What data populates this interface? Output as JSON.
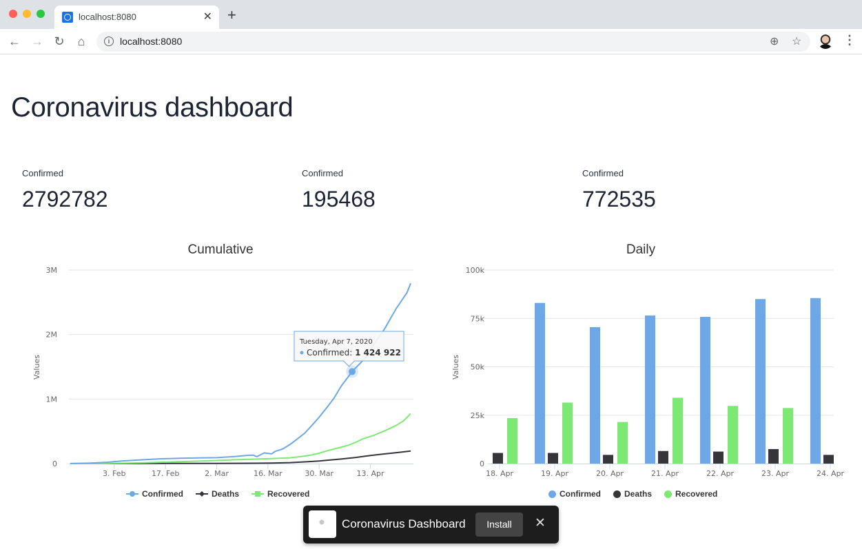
{
  "browser": {
    "tab_title": "localhost:8080",
    "url": "localhost:8080",
    "icons": {
      "back": "arrow-left-icon",
      "forward": "arrow-right-icon",
      "reload": "reload-icon",
      "home": "home-icon",
      "info": "info-icon",
      "add": "plus-circle-icon",
      "bookmark": "star-icon",
      "menu": "vertical-dots-icon"
    }
  },
  "page": {
    "title": "Coronavirus dashboard",
    "stats": [
      {
        "label": "Confirmed",
        "value": "2792782"
      },
      {
        "label": "Confirmed",
        "value": "195468"
      },
      {
        "label": "Confirmed",
        "value": "772535"
      }
    ]
  },
  "colors": {
    "confirmed": "#6ca8e6",
    "deaths": "#35353b",
    "recovered": "#7de874"
  },
  "chart_data": [
    {
      "type": "line",
      "title": "Cumulative",
      "xlabel": "",
      "ylabel": "Values",
      "ylim": [
        0,
        3000000
      ],
      "yticks": [
        {
          "v": 0,
          "label": "0"
        },
        {
          "v": 1000000,
          "label": "1M"
        },
        {
          "v": 2000000,
          "label": "2M"
        },
        {
          "v": 3000000,
          "label": "3M"
        }
      ],
      "xticks": [
        {
          "day": 12,
          "label": "3. Feb"
        },
        {
          "day": 26,
          "label": "17. Feb"
        },
        {
          "day": 40,
          "label": "2. Mar"
        },
        {
          "day": 54,
          "label": "16. Mar"
        },
        {
          "day": 68,
          "label": "30. Mar"
        },
        {
          "day": 82,
          "label": "13. Apr"
        }
      ],
      "x_start": "2020-01-22",
      "x_days": 93,
      "grid": true,
      "legend": "bottom-center",
      "series": [
        {
          "name": "Confirmed",
          "key": "confirmed",
          "points": [
            [
              0,
              555
            ],
            [
              5,
              6000
            ],
            [
              10,
              20000
            ],
            [
              14,
              40000
            ],
            [
              20,
              60000
            ],
            [
              25,
              75000
            ],
            [
              30,
              82000
            ],
            [
              35,
              88000
            ],
            [
              40,
              92000
            ],
            [
              45,
              110000
            ],
            [
              48,
              125000
            ],
            [
              50,
              130000
            ],
            [
              51,
              108000
            ],
            [
              53,
              165000
            ],
            [
              55,
              150000
            ],
            [
              56,
              190000
            ],
            [
              58,
              225000
            ],
            [
              60,
              295000
            ],
            [
              62,
              380000
            ],
            [
              64,
              470000
            ],
            [
              66,
              590000
            ],
            [
              68,
              720000
            ],
            [
              70,
              860000
            ],
            [
              72,
              1010000
            ],
            [
              74,
              1200000
            ],
            [
              76,
              1350000
            ],
            [
              77,
              1424922
            ],
            [
              80,
              1600000
            ],
            [
              83,
              1850000
            ],
            [
              86,
              2100000
            ],
            [
              89,
              2400000
            ],
            [
              92,
              2650000
            ],
            [
              93,
              2792782
            ]
          ]
        },
        {
          "name": "Deaths",
          "key": "deaths",
          "points": [
            [
              0,
              17
            ],
            [
              10,
              400
            ],
            [
              20,
              1100
            ],
            [
              30,
              2800
            ],
            [
              40,
              3200
            ],
            [
              50,
              5000
            ],
            [
              55,
              8000
            ],
            [
              60,
              15000
            ],
            [
              65,
              30000
            ],
            [
              68,
              40000
            ],
            [
              70,
              50000
            ],
            [
              74,
              70000
            ],
            [
              78,
              95000
            ],
            [
              82,
              125000
            ],
            [
              86,
              150000
            ],
            [
              90,
              175000
            ],
            [
              93,
              195468
            ]
          ]
        },
        {
          "name": "Recovered",
          "key": "recovered",
          "points": [
            [
              0,
              28
            ],
            [
              10,
              1500
            ],
            [
              20,
              12000
            ],
            [
              30,
              30000
            ],
            [
              40,
              48000
            ],
            [
              45,
              60000
            ],
            [
              50,
              68000
            ],
            [
              55,
              78000
            ],
            [
              60,
              90000
            ],
            [
              63,
              108000
            ],
            [
              66,
              135000
            ],
            [
              68,
              160000
            ],
            [
              70,
              195000
            ],
            [
              73,
              240000
            ],
            [
              76,
              285000
            ],
            [
              78,
              330000
            ],
            [
              80,
              385000
            ],
            [
              83,
              440000
            ],
            [
              86,
              510000
            ],
            [
              89,
              590000
            ],
            [
              91,
              660000
            ],
            [
              93,
              772535
            ]
          ]
        }
      ],
      "tooltip": {
        "date": "Tuesday, Apr 7, 2020",
        "series": "Confirmed",
        "value_text": "1 424 922",
        "day": 77,
        "value": 1424922
      }
    },
    {
      "type": "bar",
      "title": "Daily",
      "xlabel": "",
      "ylabel": "Values",
      "ylim": [
        0,
        100000
      ],
      "yticks": [
        {
          "v": 0,
          "label": "0"
        },
        {
          "v": 25000,
          "label": "25k"
        },
        {
          "v": 50000,
          "label": "50k"
        },
        {
          "v": 75000,
          "label": "75k"
        },
        {
          "v": 100000,
          "label": "100k"
        }
      ],
      "categories": [
        "18. Apr",
        "19. Apr",
        "20. Apr",
        "21. Apr",
        "22. Apr",
        "23. Apr",
        "24. Apr"
      ],
      "grid": true,
      "legend": "bottom-center",
      "series": [
        {
          "name": "Confirmed",
          "key": "confirmed",
          "values": [
            null,
            83000,
            70500,
            76500,
            75800,
            85000,
            85500
          ]
        },
        {
          "name": "Deaths",
          "key": "deaths",
          "values": [
            5500,
            5500,
            4500,
            6500,
            6200,
            7500,
            4500
          ]
        },
        {
          "name": "Recovered",
          "key": "recovered",
          "values": [
            23500,
            31500,
            21500,
            34000,
            29800,
            28700,
            null
          ]
        }
      ]
    }
  ],
  "legends": {
    "cumulative": [
      "Confirmed",
      "Deaths",
      "Recovered"
    ],
    "daily": [
      "Confirmed",
      "Deaths",
      "Recovered"
    ]
  },
  "install_prompt": {
    "app_name": "Coronavirus Dashboard",
    "install_label": "Install",
    "close_icon": "close-icon"
  }
}
